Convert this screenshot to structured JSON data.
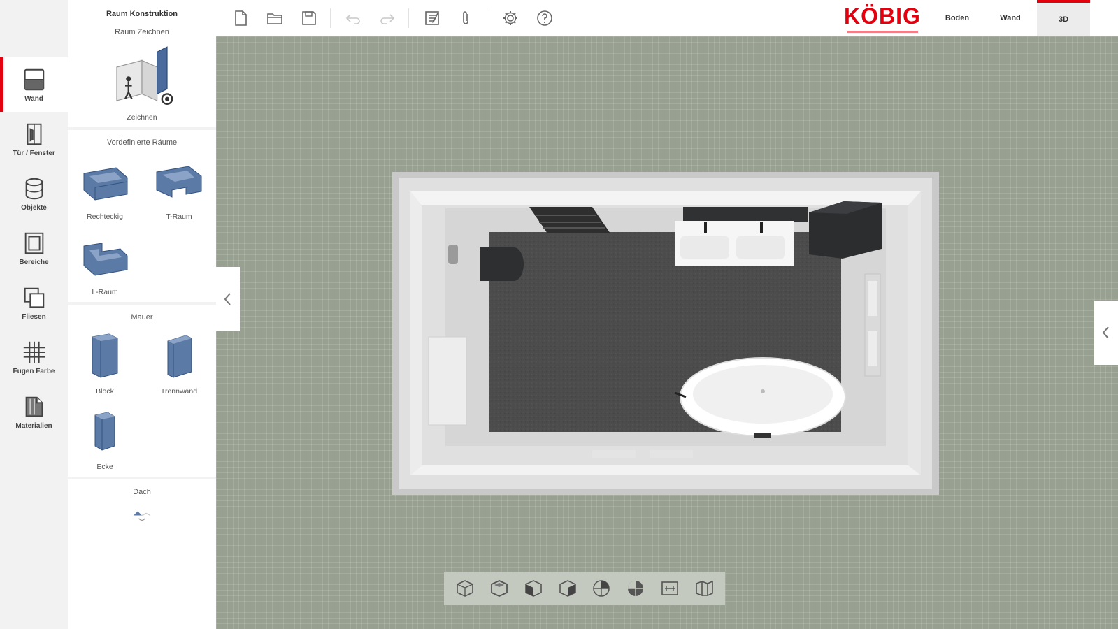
{
  "rail": {
    "items": [
      {
        "label": "Wand",
        "icon": "wall-icon",
        "active": true
      },
      {
        "label": "Tür / Fenster",
        "icon": "door-window-icon",
        "active": false
      },
      {
        "label": "Objekte",
        "icon": "objects-icon",
        "active": false
      },
      {
        "label": "Bereiche",
        "icon": "areas-icon",
        "active": false
      },
      {
        "label": "Fliesen",
        "icon": "tiles-icon",
        "active": false
      },
      {
        "label": "Fugen Farbe",
        "icon": "grout-color-icon",
        "active": false
      },
      {
        "label": "Materialien",
        "icon": "materials-icon",
        "active": false
      }
    ]
  },
  "panel": {
    "title": "Raum Konstruktion",
    "sections": [
      {
        "title": "Raum Zeichnen",
        "items": [
          {
            "label": "Zeichnen"
          }
        ]
      },
      {
        "title": "Vordefinierte Räume",
        "items": [
          {
            "label": "Rechteckig"
          },
          {
            "label": "T-Raum"
          },
          {
            "label": "L-Raum"
          }
        ]
      },
      {
        "title": "Mauer",
        "items": [
          {
            "label": "Block"
          },
          {
            "label": "Trennwand"
          },
          {
            "label": "Ecke"
          }
        ]
      },
      {
        "title": "Dach",
        "items": []
      }
    ]
  },
  "toolbar": {
    "buttons": [
      {
        "name": "new-file",
        "icon": "new-file-icon"
      },
      {
        "name": "open-folder",
        "icon": "open-folder-icon"
      },
      {
        "name": "save",
        "icon": "save-icon"
      },
      {
        "name": "undo",
        "icon": "undo-icon",
        "disabled": true
      },
      {
        "name": "redo",
        "icon": "redo-icon",
        "disabled": true
      },
      {
        "name": "notes",
        "icon": "notes-icon"
      },
      {
        "name": "attachment",
        "icon": "paperclip-icon"
      },
      {
        "name": "settings",
        "icon": "gear-icon"
      },
      {
        "name": "help",
        "icon": "help-icon"
      }
    ],
    "logo_text": "KÖBIG",
    "view_tabs": [
      {
        "label": "Boden",
        "active": false
      },
      {
        "label": "Wand",
        "active": false
      },
      {
        "label": "3D",
        "active": true
      }
    ]
  },
  "view_controls": {
    "buttons": [
      {
        "name": "view-iso",
        "icon": "cube-outline-icon"
      },
      {
        "name": "view-top",
        "icon": "cube-top-icon"
      },
      {
        "name": "view-front",
        "icon": "cube-front-icon"
      },
      {
        "name": "view-side",
        "icon": "cube-side-icon"
      },
      {
        "name": "view-rotate",
        "icon": "cube-rotate-icon"
      },
      {
        "name": "view-shaded",
        "icon": "cube-shaded-icon"
      },
      {
        "name": "view-measure",
        "icon": "measure-icon"
      },
      {
        "name": "view-walls",
        "icon": "walls-toggle-icon"
      }
    ]
  },
  "colors": {
    "accent": "#e3000f",
    "canvas": "#98a191",
    "rail": "#f2f2f2",
    "object_blue": "#5b7aa6"
  }
}
